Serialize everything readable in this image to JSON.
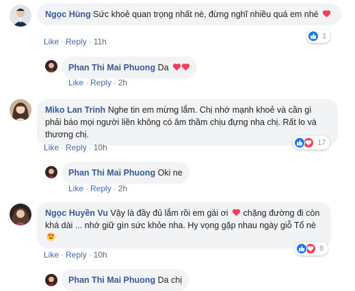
{
  "colors": {
    "name": "#385898",
    "link": "#4267b2",
    "bubble": "#f2f3f5",
    "like_blue": "#1877f2",
    "love_red": "#f33e58"
  },
  "actions": {
    "like": "Like",
    "reply": "Reply",
    "separator": "·"
  },
  "comments": [
    {
      "author": "Ngọc Hùng",
      "text": "Sức khoẻ quan trọng nhất nè, đừng nghĩ nhiều quá em nhé",
      "emoji": "heart-icon",
      "time": "11h",
      "reactions": {
        "icons": [
          "like-icon"
        ],
        "count": "1"
      },
      "reply": {
        "author": "Phan Thi Mai Phuong",
        "text": "Da",
        "emoji": "heart-icon x2",
        "time": "2h"
      }
    },
    {
      "author": "Miko Lan Trinh",
      "text": "Nghe tin em mừng lắm. Chị nhớ mạnh khoẻ và cần gì phải báo mọi người liền không có âm thầm chịu đựng nha chị. Rất lo và thương chị.",
      "time": "10h",
      "reactions": {
        "icons": [
          "like-icon",
          "love-icon"
        ],
        "count": "17"
      },
      "reply": {
        "author": "Phan Thi Mai Phuong",
        "text": "Oki ne",
        "time": "2h"
      }
    },
    {
      "author": "Ngọc Huyền Vu",
      "text_before": "Vậy là đầy đủ lắm rồi em gái ơi",
      "text_after": "chặng đường đi còn khá dài ... nhớ giữ gìn sức khỏe nha. Hy vọng gặp nhau ngày giỗ Tổ nè",
      "emoji": "heart-icon, heart-eyes-emoji",
      "time": "10h",
      "reactions": {
        "icons": [
          "like-icon",
          "love-icon"
        ],
        "count": "8"
      },
      "reply": {
        "author": "Phan Thi Mai Phuong",
        "text": "Da chị"
      }
    }
  ]
}
